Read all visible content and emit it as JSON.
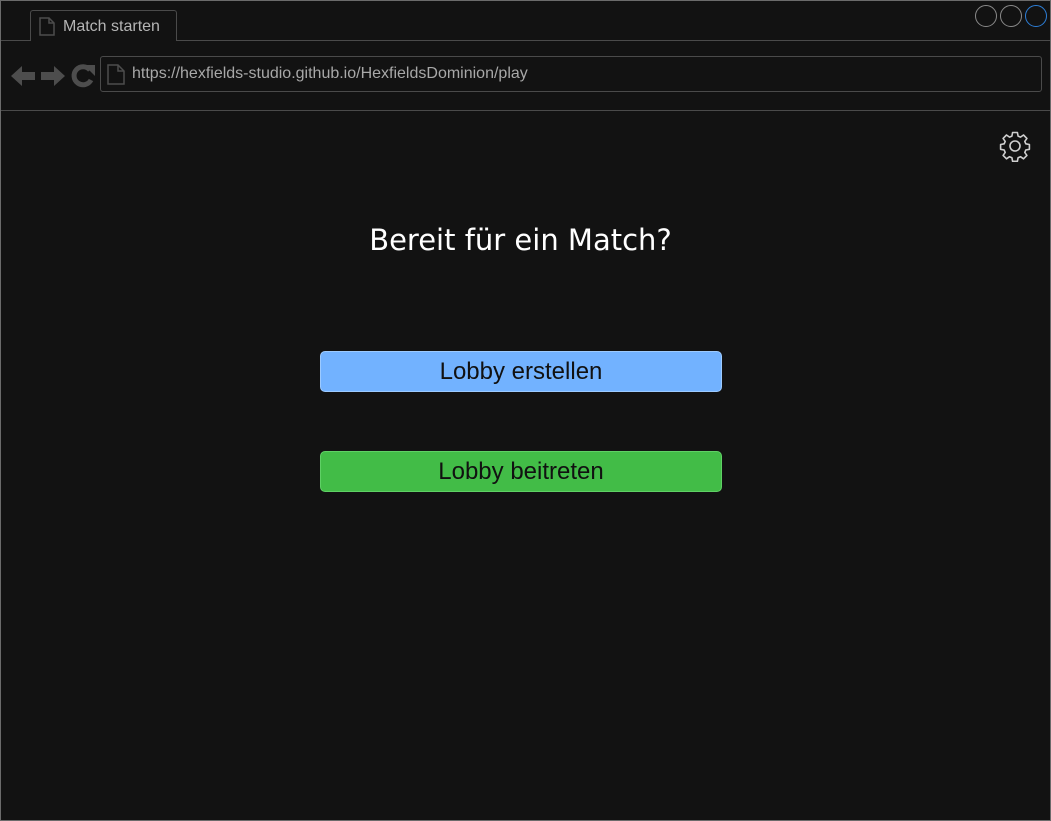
{
  "browser": {
    "tab": {
      "title": "Match starten",
      "icon": "page-icon"
    },
    "window_controls": [
      "minimize",
      "maximize",
      "close"
    ],
    "nav": {
      "back_icon": "back-arrow-icon",
      "forward_icon": "forward-arrow-icon",
      "reload_icon": "reload-icon",
      "url": "https://hexfields-studio.github.io/HexfieldsDominion/play"
    }
  },
  "page": {
    "settings_icon": "gear-icon",
    "heading": "Bereit für ein Match?",
    "buttons": {
      "create_lobby": "Lobby erstellen",
      "join_lobby": "Lobby beitreten"
    }
  },
  "colors": {
    "background": "#121212",
    "create_button": "#72b2ff",
    "join_button": "#42bc47",
    "active_window_control": "#2d7fd8"
  }
}
